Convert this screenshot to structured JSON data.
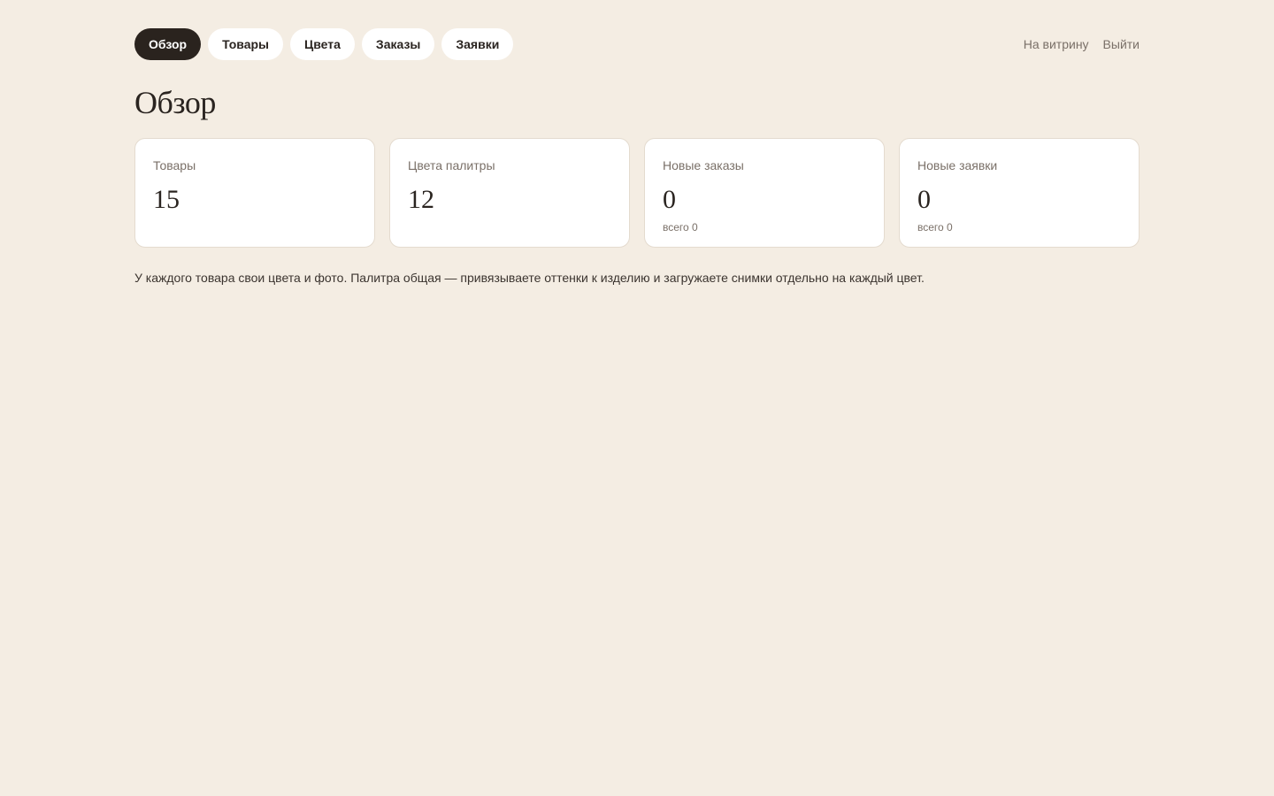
{
  "nav": {
    "items": [
      {
        "label": "Обзор",
        "active": true
      },
      {
        "label": "Товары",
        "active": false
      },
      {
        "label": "Цвета",
        "active": false
      },
      {
        "label": "Заказы",
        "active": false
      },
      {
        "label": "Заявки",
        "active": false
      }
    ]
  },
  "header_links": {
    "storefront": "На витрину",
    "logout": "Выйти"
  },
  "page": {
    "title": "Обзор"
  },
  "stats": [
    {
      "label": "Товары",
      "value": "15",
      "sub": ""
    },
    {
      "label": "Цвета палитры",
      "value": "12",
      "sub": ""
    },
    {
      "label": "Новые заказы",
      "value": "0",
      "sub": "всего 0"
    },
    {
      "label": "Новые заявки",
      "value": "0",
      "sub": "всего 0"
    }
  ],
  "note": "У каждого товара свои цвета и фото. Палитра общая — привязываете оттенки к изделию и загружаете снимки отдельно на каждый цвет.",
  "colors": {
    "background": "#f4ede3",
    "active_pill": "#2a231e",
    "card": "#ffffff",
    "muted_text": "#7a7068"
  }
}
